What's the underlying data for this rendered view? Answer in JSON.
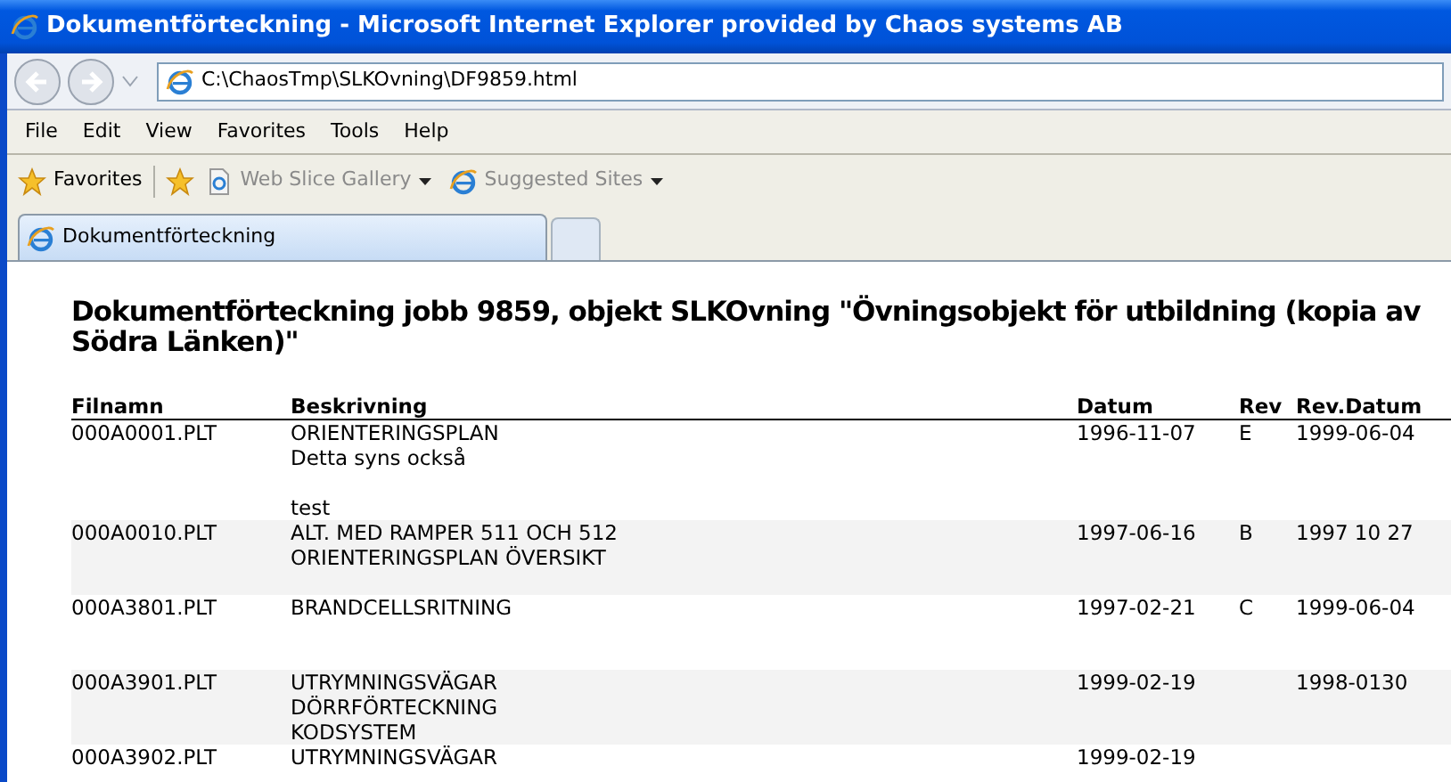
{
  "window": {
    "title": "Dokumentförteckning - Microsoft Internet Explorer provided by Chaos systems AB"
  },
  "address_bar": {
    "value": "C:\\ChaosTmp\\SLKOvning\\DF9859.html"
  },
  "menu": [
    "File",
    "Edit",
    "View",
    "Favorites",
    "Tools",
    "Help"
  ],
  "favorites_bar": {
    "favorites": "Favorites",
    "links": [
      {
        "label": "Web Slice Gallery"
      },
      {
        "label": "Suggested Sites"
      }
    ]
  },
  "tabs": [
    {
      "label": "Dokumentförteckning",
      "selected": true
    }
  ],
  "page": {
    "heading": "Dokumentförteckning jobb 9859, objekt SLKOvning \"Övningsobjekt för utbildning (kopia av Södra Länken)\"",
    "table": {
      "columns": [
        "Filnamn",
        "Beskrivning",
        "Datum",
        "Rev",
        "Rev.Datum"
      ],
      "rows": [
        {
          "shaded": false,
          "file": "000A0001.PLT",
          "description": "ORIENTERINGSPLAN\nDetta syns också\n\ntest",
          "date": "1996-11-07",
          "rev": "E",
          "rev_date": "1999-06-04"
        },
        {
          "shaded": true,
          "file": "000A0010.PLT",
          "description": "ALT. MED RAMPER 511 OCH 512\nORIENTERINGSPLAN ÖVERSIKT",
          "date": "1997-06-16",
          "rev": "B",
          "rev_date": "1997 10 27"
        },
        {
          "shaded": false,
          "file": "000A3801.PLT",
          "description": "BRANDCELLSRITNING",
          "date": "1997-02-21",
          "rev": "C",
          "rev_date": "1999-06-04"
        },
        {
          "shaded": true,
          "file": "000A3901.PLT",
          "description": "UTRYMNINGSVÄGAR\nDÖRRFÖRTECKNING\nKODSYSTEM",
          "date": "1999-02-19",
          "rev_date": "1998-0130"
        },
        {
          "shaded": false,
          "file": "000A3902.PLT",
          "description": "UTRYMNINGSVÄGAR",
          "date": "1999-02-19"
        }
      ]
    }
  }
}
